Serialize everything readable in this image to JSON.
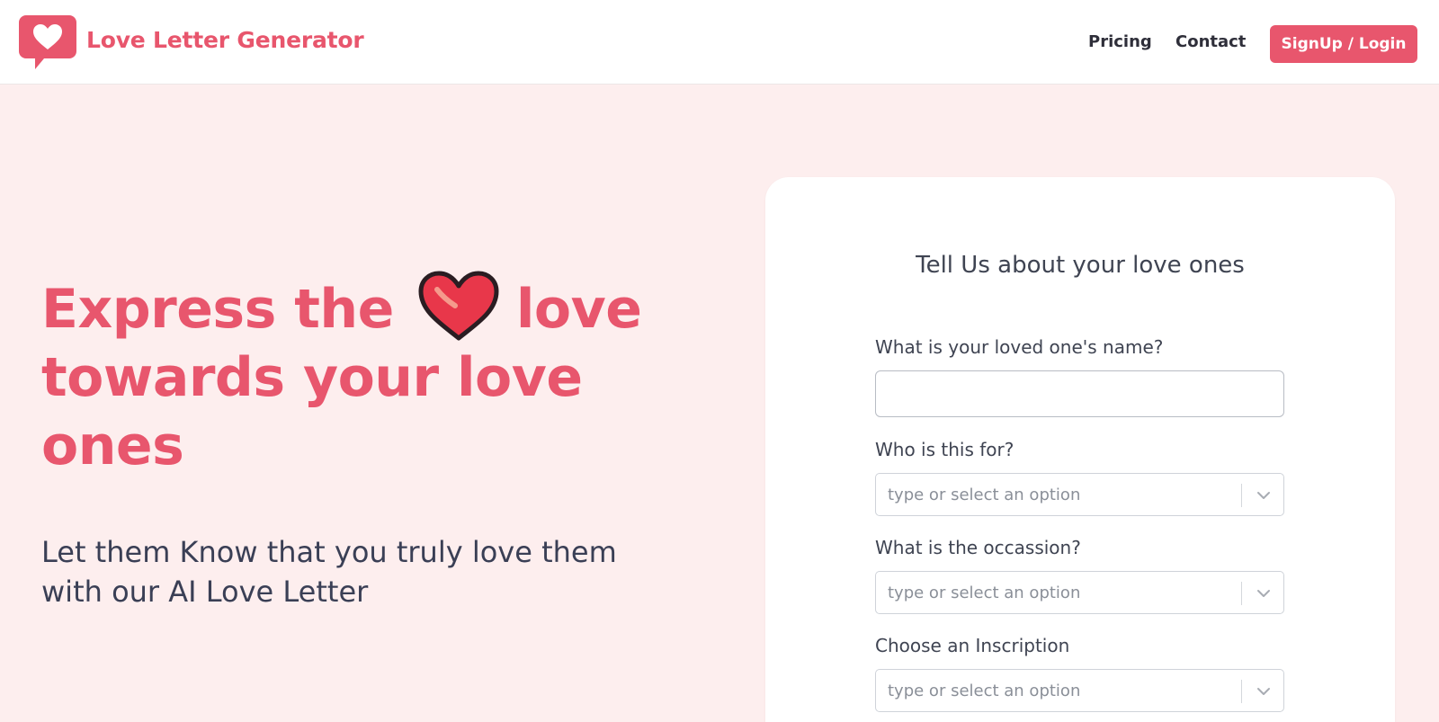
{
  "header": {
    "brand": "Love Letter Generator",
    "nav": {
      "pricing": "Pricing",
      "contact": "Contact",
      "signup": "SignUp / Login"
    }
  },
  "hero": {
    "title_part1": "Express the",
    "title_part2": "love",
    "title_line2": "towards your love",
    "title_line3": "ones",
    "subtitle_line1": "Let them Know that you truly love them",
    "subtitle_line2": "with our AI Love Letter"
  },
  "form": {
    "title": "Tell Us about your love ones",
    "name_label": "What is your loved one's name?",
    "name_value": "",
    "recipient_label": "Who is this for?",
    "recipient_placeholder": "type or select an option",
    "occasion_label": "What is the occassion?",
    "occasion_placeholder": "type or select an option",
    "inscription_label": "Choose an Inscription",
    "inscription_placeholder": "type or select an option"
  },
  "colors": {
    "accent": "#e8566d",
    "background": "#fdeeee",
    "card": "#ffffff",
    "heading_text": "#3f4452"
  },
  "icons": {
    "logo": "heart-speech-bubble-icon",
    "hero": "red-heart-icon",
    "select_toggle": "chevron-down-icon"
  }
}
